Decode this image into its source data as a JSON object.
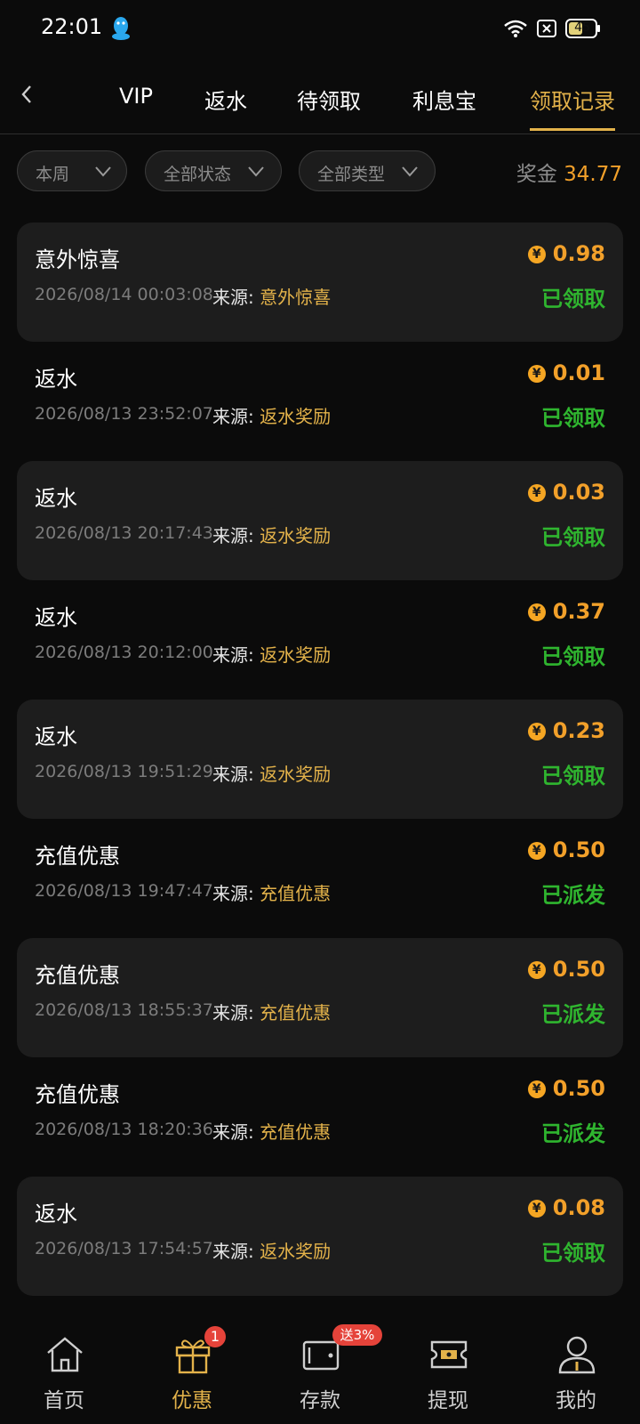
{
  "status_bar": {
    "time": "22:01",
    "battery": "45"
  },
  "tabs": [
    {
      "label": "VIP"
    },
    {
      "label": "返水"
    },
    {
      "label": "待领取"
    },
    {
      "label": "利息宝"
    },
    {
      "label": "领取记录",
      "active": true
    }
  ],
  "filters": [
    {
      "label": "本周"
    },
    {
      "label": "全部状态"
    },
    {
      "label": "全部类型"
    }
  ],
  "bonus": {
    "label": "奖金",
    "value": "34.77"
  },
  "source_label": "来源:",
  "records": [
    {
      "title": "意外惊喜",
      "time": "2026/08/14 00:03:08",
      "source": "意外惊喜",
      "amount": "0.98",
      "status": "已领取"
    },
    {
      "title": "返水",
      "time": "2026/08/13 23:52:07",
      "source": "返水奖励",
      "amount": "0.01",
      "status": "已领取"
    },
    {
      "title": "返水",
      "time": "2026/08/13 20:17:43",
      "source": "返水奖励",
      "amount": "0.03",
      "status": "已领取"
    },
    {
      "title": "返水",
      "time": "2026/08/13 20:12:00",
      "source": "返水奖励",
      "amount": "0.37",
      "status": "已领取"
    },
    {
      "title": "返水",
      "time": "2026/08/13 19:51:29",
      "source": "返水奖励",
      "amount": "0.23",
      "status": "已领取"
    },
    {
      "title": "充值优惠",
      "time": "2026/08/13 19:47:47",
      "source": "充值优惠",
      "amount": "0.50",
      "status": "已派发"
    },
    {
      "title": "充值优惠",
      "time": "2026/08/13 18:55:37",
      "source": "充值优惠",
      "amount": "0.50",
      "status": "已派发"
    },
    {
      "title": "充值优惠",
      "time": "2026/08/13 18:20:36",
      "source": "充值优惠",
      "amount": "0.50",
      "status": "已派发"
    },
    {
      "title": "返水",
      "time": "2026/08/13 17:54:57",
      "source": "返水奖励",
      "amount": "0.08",
      "status": "已领取"
    }
  ],
  "coin_symbol": "¥",
  "bottom_nav": [
    {
      "label": "首页",
      "icon": "home-icon"
    },
    {
      "label": "优惠",
      "icon": "gift-icon",
      "active": true,
      "badge": "1"
    },
    {
      "label": "存款",
      "icon": "wallet-icon",
      "badge": "送3%"
    },
    {
      "label": "提现",
      "icon": "withdraw-ticket-icon"
    },
    {
      "label": "我的",
      "icon": "user-icon"
    }
  ],
  "colors": {
    "accent": "#e3b24a",
    "amount": "#f2a02a",
    "success": "#2fb52f",
    "badge": "#e5433a"
  }
}
